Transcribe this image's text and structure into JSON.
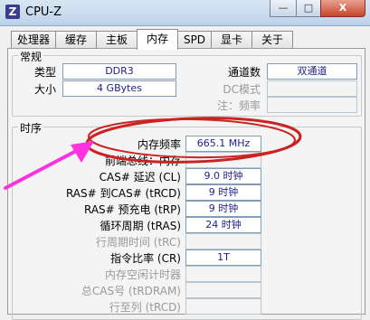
{
  "window": {
    "title": "CPU-Z",
    "app_icon": "Z",
    "minimize": "—",
    "maximize": "□",
    "close": "X"
  },
  "tabs": [
    "处理器",
    "缓存",
    "主板",
    "内存",
    "SPD",
    "显卡",
    "关于"
  ],
  "active_tab": "内存",
  "general": {
    "title": "常规",
    "type_label": "类型",
    "type_value": "DDR3",
    "size_label": "大小",
    "size_value": "4 GBytes",
    "channels_label": "通道数",
    "channels_value": "双通道",
    "dc_mode_label": "DC模式",
    "dc_mode_value": "",
    "nb_freq_label": "注：频率",
    "nb_freq_value": ""
  },
  "timings": {
    "title": "时序",
    "rows": [
      {
        "label": "内存频率",
        "value": "665.1 MHz",
        "enabled": true
      },
      {
        "label": "前端总线：内存",
        "value": "",
        "enabled": true
      },
      {
        "label": "CAS# 延迟 (CL)",
        "value": "9.0 时钟",
        "enabled": true
      },
      {
        "label": "RAS# 到CAS# (tRCD)",
        "value": "9 时钟",
        "enabled": true
      },
      {
        "label": "RAS# 预充电 (tRP)",
        "value": "9 时钟",
        "enabled": true
      },
      {
        "label": "循环周期 (tRAS)",
        "value": "24 时钟",
        "enabled": true
      },
      {
        "label": "行周期时间 (tRC)",
        "value": "",
        "enabled": false
      },
      {
        "label": "指令比率 (CR)",
        "value": "1T",
        "enabled": true
      },
      {
        "label": "内存空闲计时器",
        "value": "",
        "enabled": false
      },
      {
        "label": "总CAS号 (tRDRAM)",
        "value": "",
        "enabled": false
      },
      {
        "label": "行至列 (tRCD)",
        "value": "",
        "enabled": false
      }
    ]
  },
  "annotation": {
    "ellipse_color": "#cc2222",
    "arrow_color": "#ff33dd"
  }
}
